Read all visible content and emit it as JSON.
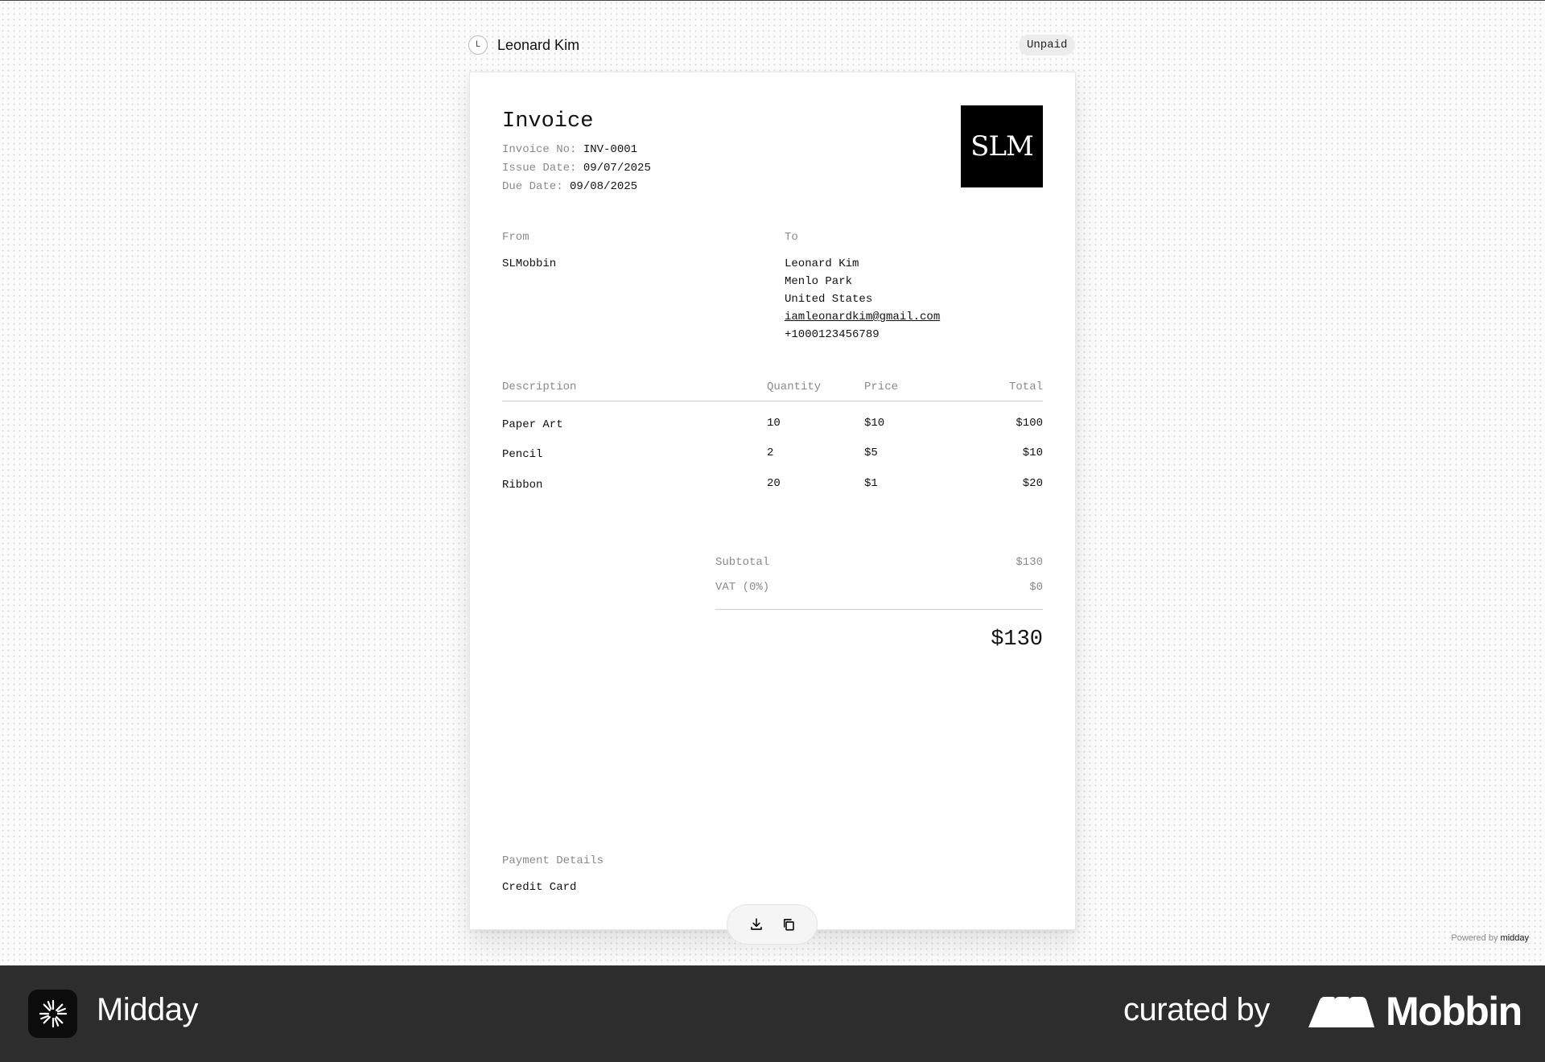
{
  "header": {
    "customer_initial": "L",
    "customer_name": "Leonard Kim",
    "status": "Unpaid"
  },
  "invoice": {
    "title": "Invoice",
    "invoice_no_label": "Invoice No:",
    "invoice_no": "INV-0001",
    "issue_date_label": "Issue Date:",
    "issue_date": "09/07/2025",
    "due_date_label": "Due Date:",
    "due_date": "09/08/2025",
    "logo_text": "SLM",
    "from": {
      "label": "From",
      "name": "SLMobbin"
    },
    "to": {
      "label": "To",
      "name": "Leonard Kim",
      "city": "Menlo Park",
      "country": "United States",
      "email": "iamleonardkim@gmail.com",
      "phone": "+1000123456789"
    },
    "columns": {
      "description": "Description",
      "quantity": "Quantity",
      "price": "Price",
      "total": "Total"
    },
    "items": [
      {
        "description": "Paper Art",
        "quantity": "10",
        "price": "$10",
        "total": "$100"
      },
      {
        "description": "Pencil",
        "quantity": "2",
        "price": "$5",
        "total": "$10"
      },
      {
        "description": "Ribbon",
        "quantity": "20",
        "price": "$1",
        "total": "$20"
      }
    ],
    "subtotal_label": "Subtotal",
    "subtotal": "$130",
    "vat_label": "VAT (0%)",
    "vat": "$0",
    "grand_total": "$130",
    "payment_label": "Payment Details",
    "payment_method": "Credit Card"
  },
  "toolbar": {
    "download_icon": "download-icon",
    "copy_icon": "copy-icon"
  },
  "footer": {
    "powered_prefix": "Powered by",
    "powered_brand": "midday"
  },
  "banner": {
    "app_name": "Midday",
    "curated_label": "curated by",
    "brand_name": "Mobbin"
  }
}
